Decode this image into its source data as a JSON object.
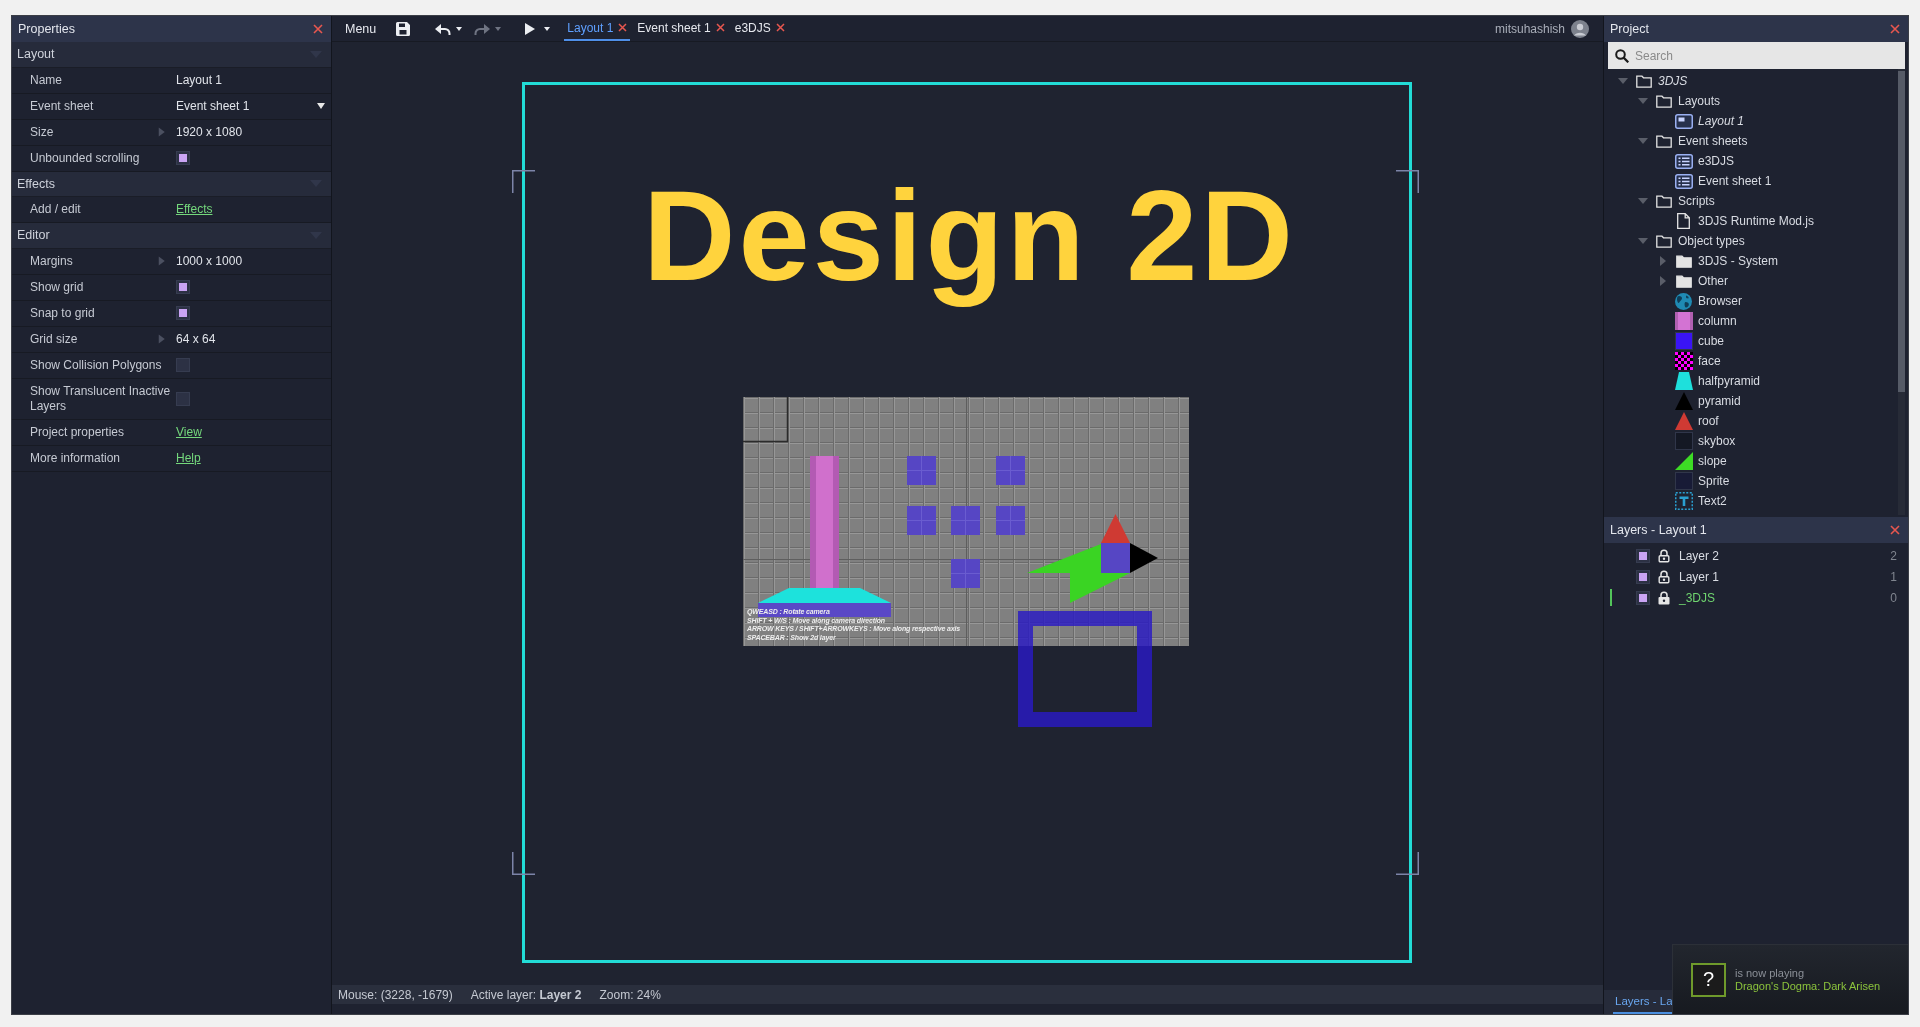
{
  "properties": {
    "title": "Properties",
    "sections": [
      {
        "label": "Layout",
        "expanded": true,
        "rows": [
          {
            "label": "Name",
            "kind": "text",
            "value": "Layout 1"
          },
          {
            "label": "Event sheet",
            "kind": "dropdown",
            "value": "Event sheet 1"
          },
          {
            "label": "Size",
            "kind": "group",
            "value": "1920 x 1080",
            "expanded": false
          },
          {
            "label": "Unbounded scrolling",
            "kind": "checkbox",
            "checked": true
          }
        ]
      },
      {
        "label": "Effects",
        "expanded": true,
        "rows": [
          {
            "label": "Add / edit",
            "kind": "link",
            "value": "Effects"
          }
        ]
      },
      {
        "label": "Editor",
        "expanded": true,
        "rows": [
          {
            "label": "Margins",
            "kind": "group",
            "value": "1000 x 1000",
            "expanded": false
          },
          {
            "label": "Show grid",
            "kind": "checkbox",
            "checked": true
          },
          {
            "label": "Snap to grid",
            "kind": "checkbox",
            "checked": true
          },
          {
            "label": "Grid size",
            "kind": "group",
            "value": "64 x 64",
            "expanded": false
          },
          {
            "label": "Show Collision Polygons",
            "kind": "checkbox",
            "checked": false
          },
          {
            "label": "Show Translucent Inactive Layers",
            "kind": "checkbox",
            "checked": false
          },
          {
            "label": "Project properties",
            "kind": "link",
            "value": "View"
          },
          {
            "label": "More information",
            "kind": "link",
            "value": "Help"
          }
        ]
      }
    ]
  },
  "toolbar": {
    "menu": "Menu",
    "buttons": [
      {
        "kind": "save",
        "disabled": false,
        "dropdown": false
      },
      {
        "kind": "undo",
        "disabled": false,
        "dropdown": true
      },
      {
        "kind": "redo",
        "disabled": true,
        "dropdown": true
      },
      {
        "kind": "run",
        "disabled": false,
        "dropdown": true
      }
    ],
    "tabs": [
      {
        "label": "Layout 1",
        "selected": true
      },
      {
        "label": "Event sheet 1",
        "selected": false
      },
      {
        "label": "e3DJS",
        "selected": false
      }
    ],
    "user": "mitsuhashish"
  },
  "layout": {
    "title_text": "Design 2D",
    "preview": {
      "hints": [
        "QWEASD : Rotate camera",
        "SHIFT + W/S : Move along camera direction",
        "ARROW KEYS / SHIFT+ARROWKEYS : Move along respective axis",
        "SPACEBAR : Show 2d layer"
      ]
    }
  },
  "status_bar": {
    "mouse": "Mouse: (3228, -1679)",
    "active_layer": "Active layer: **Layer 2**",
    "zoom": "Zoom: 24%"
  },
  "project": {
    "title": "Project",
    "search": {
      "placeholder": "Search"
    },
    "tree": [
      {
        "label": "3DJS",
        "kind": "project",
        "expanded": true,
        "children": [
          {
            "label": "Layouts",
            "kind": "folder",
            "expanded": true,
            "children": [
              {
                "label": "Layout 1",
                "kind": "layout",
                "startup": true
              }
            ]
          },
          {
            "label": "Event sheets",
            "kind": "folder",
            "expanded": true,
            "children": [
              {
                "label": "e3DJS",
                "kind": "sheet"
              },
              {
                "label": "Event sheet 1",
                "kind": "sheet"
              }
            ]
          },
          {
            "label": "Scripts",
            "kind": "folder",
            "expanded": true,
            "children": [
              {
                "label": "3DJS Runtime Mod.js",
                "kind": "script"
              }
            ]
          },
          {
            "label": "Object types",
            "kind": "folder",
            "expanded": true,
            "children": [
              {
                "label": "3DJS - System",
                "kind": "folder",
                "expanded": false
              },
              {
                "label": "Other",
                "kind": "folder",
                "expanded": false
              },
              {
                "label": "Browser",
                "kind": "plugin"
              },
              {
                "label": "column",
                "kind": "column",
                "color": "#d373d3"
              },
              {
                "label": "cube",
                "kind": "tile",
                "color": "#3a14f5"
              },
              {
                "label": "face",
                "kind": "checker",
                "color": "#ff00ff"
              },
              {
                "label": "halfpyramid",
                "kind": "trapezoid",
                "color": "#1ee0dc"
              },
              {
                "label": "pyramid",
                "kind": "triangle",
                "color": "#000000"
              },
              {
                "label": "roof",
                "kind": "triangle",
                "color": "#cf3a33"
              },
              {
                "label": "skybox",
                "kind": "tile",
                "color": "#141824"
              },
              {
                "label": "slope",
                "kind": "slope",
                "color": "#3ddc25"
              },
              {
                "label": "Sprite",
                "kind": "tile",
                "color": "#181b36"
              },
              {
                "label": "Text2",
                "kind": "text"
              }
            ]
          }
        ]
      }
    ]
  },
  "layers": {
    "title": "Layers - Layout 1",
    "rows": [
      {
        "name": "Layer 2",
        "index": "2",
        "visible": true,
        "locked": false,
        "global": false
      },
      {
        "name": "Layer 1",
        "index": "1",
        "visible": true,
        "locked": false,
        "global": false
      },
      {
        "name": "_3DJS",
        "index": "0",
        "visible": true,
        "locked": true,
        "global": true
      }
    ]
  },
  "dock_tabs": [
    {
      "label": "Layers - La",
      "selected": true
    }
  ],
  "notification": {
    "badge": "?",
    "status": "is now playing",
    "game": "Dragon's Dogma: Dark Arisen"
  }
}
